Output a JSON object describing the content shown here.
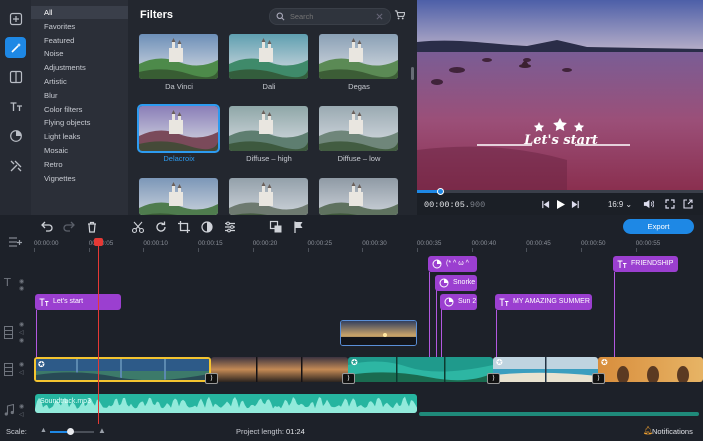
{
  "rail": {
    "items": [
      {
        "icon": "import-plus-icon"
      },
      {
        "icon": "magic-wand-icon",
        "active": true
      },
      {
        "icon": "transitions-icon"
      },
      {
        "icon": "titles-icon"
      },
      {
        "icon": "stickers-icon"
      },
      {
        "icon": "tools-icon"
      }
    ]
  },
  "categories": {
    "items": [
      "All",
      "Favorites",
      "Featured",
      "Noise",
      "Adjustments",
      "Artistic",
      "Blur",
      "Color filters",
      "Flying objects",
      "Light leaks",
      "Mosaic",
      "Retro",
      "Vignettes"
    ],
    "selected": "All"
  },
  "filters": {
    "title": "Filters",
    "search_placeholder": "Search",
    "items": [
      {
        "label": "Da Vinci"
      },
      {
        "label": "Dali"
      },
      {
        "label": "Degas"
      },
      {
        "label": "Delacroix",
        "selected": true
      },
      {
        "label": "Diffuse – high"
      },
      {
        "label": "Diffuse – low"
      },
      {
        "label": ""
      },
      {
        "label": ""
      },
      {
        "label": ""
      }
    ]
  },
  "preview": {
    "overlay_text": "Let's start",
    "timecode_main": "00:00:05.",
    "timecode_frac": "900",
    "progress": 0.08,
    "aspect": "16:9"
  },
  "toolbar": {
    "export_label": "Export"
  },
  "timeline": {
    "ticks": [
      "00:00:00",
      "00:00:05",
      "00:00:10",
      "00:00:15",
      "00:00:20",
      "00:00:25",
      "00:00:30",
      "00:00:35",
      "00:00:40",
      "00:00:45",
      "00:00:50",
      "00:00:55"
    ],
    "titles": [
      {
        "text": "Let's start"
      },
      {
        "text": "(* ^ ω ^"
      },
      {
        "text": "Snorke"
      },
      {
        "text": "Sun 2"
      },
      {
        "text": "MY AMAZING SUMMER"
      },
      {
        "text": "FRIENDSHIP"
      }
    ],
    "audio_label": "Soundtrack.mp3"
  },
  "status": {
    "scale_label": "Scale:",
    "scale_value": 0.45,
    "project_length_label": "Project length:",
    "project_length_value": "01:24",
    "notifications_label": "Notifications"
  },
  "colors": {
    "accent": "#1e88e5",
    "title_chip": "#9b3fd0",
    "audio": "#26b5a0",
    "playhead": "#e53935"
  }
}
